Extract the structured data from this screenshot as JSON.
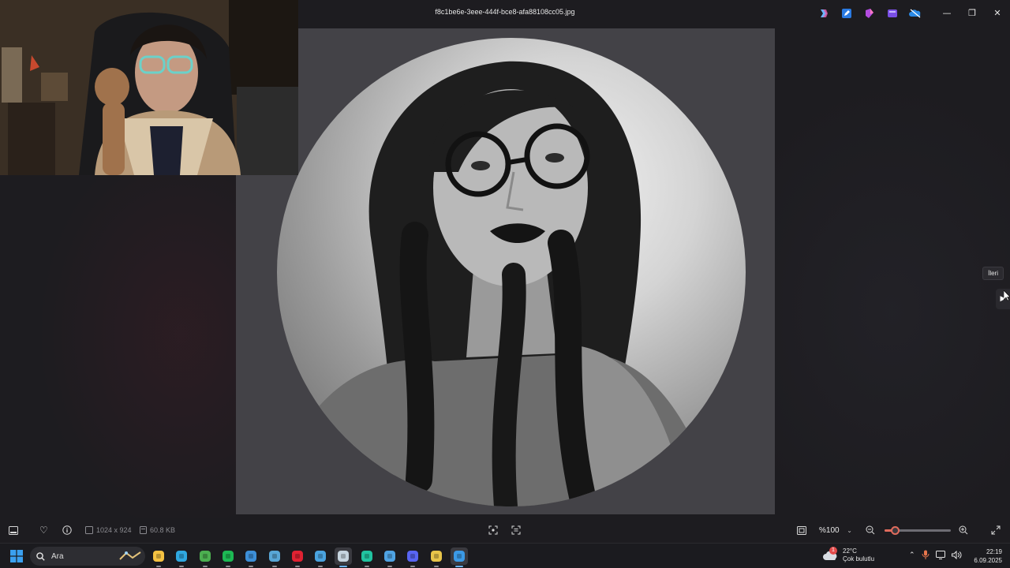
{
  "window": {
    "title": "f8c1be6e-3eee-444f-bce8-afa88108cc05.jpg",
    "minimize_symbol": "—",
    "maximize_symbol": "❐",
    "close_symbol": "✕"
  },
  "title_actions": [
    {
      "name": "copilot-icon"
    },
    {
      "name": "edit-icon"
    },
    {
      "name": "designer-icon"
    },
    {
      "name": "clipchamp-icon"
    },
    {
      "name": "onedrive-icon"
    }
  ],
  "viewer": {
    "next_tooltip": "İleri",
    "next_symbol": "▶"
  },
  "bottombar": {
    "dimensions": "1024 x 924",
    "file_size": "60.8 KB",
    "zoom_value": "%100",
    "zoom_percent": 16
  },
  "taskbar": {
    "search_placeholder": "Ara",
    "apps": [
      {
        "name": "file-explorer-icon",
        "color": "#f5c242"
      },
      {
        "name": "edge-icon",
        "color": "#2fa8e0"
      },
      {
        "name": "app-green-icon",
        "color": "#4caf50"
      },
      {
        "name": "spotify-icon",
        "color": "#1db954"
      },
      {
        "name": "app-blue-icon",
        "color": "#3d8fd8"
      },
      {
        "name": "app-picture-icon",
        "color": "#58a6d6"
      },
      {
        "name": "opera-icon",
        "color": "#e02232"
      },
      {
        "name": "notepad-icon",
        "color": "#4aa3df"
      },
      {
        "name": "steam-icon",
        "color": "#c6d4df"
      },
      {
        "name": "app-teal-icon",
        "color": "#21c3a0"
      },
      {
        "name": "app-browser-icon",
        "color": "#4fa3e3"
      },
      {
        "name": "discord-icon",
        "color": "#5865f2"
      },
      {
        "name": "app-yellow-icon",
        "color": "#e8c54a"
      },
      {
        "name": "photos-icon",
        "color": "#3b9ae6"
      }
    ],
    "weather_temp": "22°C",
    "weather_desc": "Çok bulutlu",
    "weather_badge": "1",
    "time": "22:19",
    "date": "6.09.2025"
  }
}
